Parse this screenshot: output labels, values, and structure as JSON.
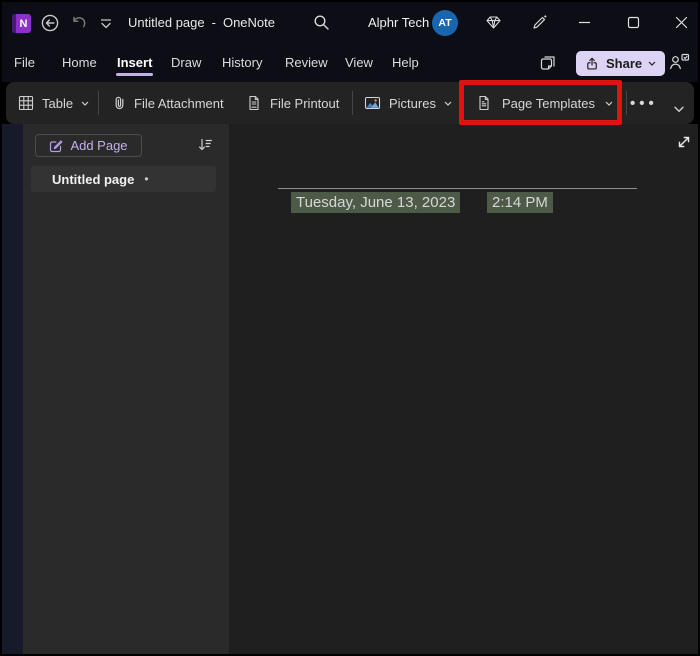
{
  "titlebar": {
    "title_page": "Untitled page",
    "title_separator": "-",
    "title_app": "OneNote",
    "account_name": "Alphr Tech",
    "avatar_initials": "AT"
  },
  "menubar": {
    "tabs": [
      "File",
      "Home",
      "Insert",
      "Draw",
      "History",
      "Review",
      "View",
      "Help"
    ],
    "active_tab": "Insert",
    "share_label": "Share"
  },
  "ribbon": {
    "table_label": "Table",
    "file_attachment_label": "File Attachment",
    "file_printout_label": "File Printout",
    "pictures_label": "Pictures",
    "page_templates_label": "Page Templates",
    "more_label": "•••"
  },
  "sidebar": {
    "add_page_label": "Add Page",
    "page_item": {
      "title": "Untitled page",
      "unsaved_dot": "•"
    }
  },
  "canvas": {
    "date_stamp": "Tuesday, June 13, 2023",
    "time_stamp": "2:14 PM"
  },
  "colors": {
    "highlight_green": "#4e5a48",
    "annotation_red": "#e01212",
    "share_button_bg": "#ddd3f4",
    "accent_purple": "#c4afe9",
    "avatar_blue": "#1766ae",
    "onenote_purple": "#8b31c9"
  }
}
